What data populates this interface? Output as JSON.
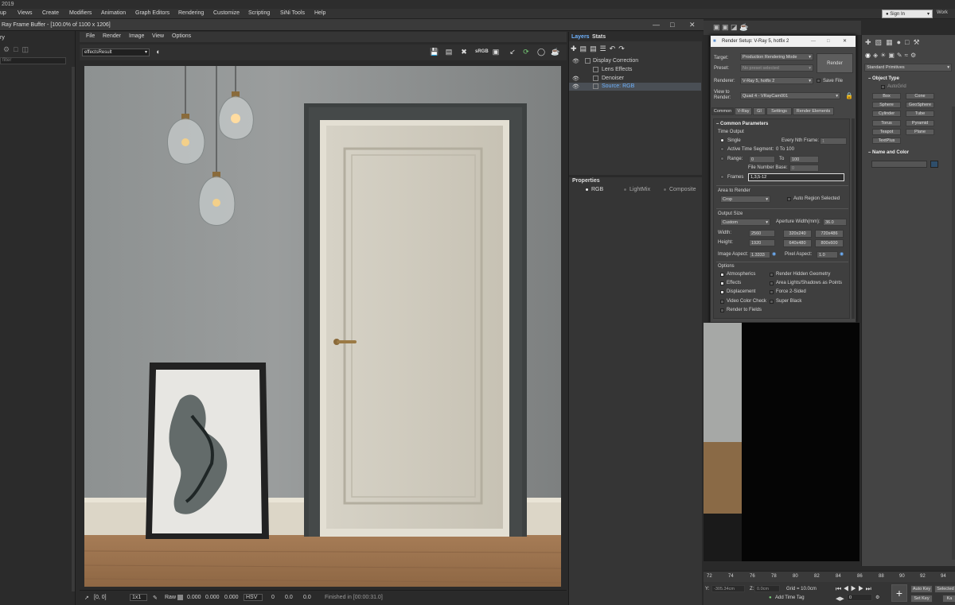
{
  "app": {
    "title": "2019",
    "signin": "Sign In",
    "workspace": "Work"
  },
  "menu": [
    "up",
    "Views",
    "Create",
    "Modifiers",
    "Animation",
    "Graph Editors",
    "Rendering",
    "Customize",
    "Scripting",
    "SiNi Tools",
    "Help"
  ],
  "left": {
    "label": "ry",
    "search": "filter"
  },
  "vfb": {
    "title": "Ray Frame Buffer - [100.0% of 1100 x 1206]",
    "menu": [
      "File",
      "Render",
      "Image",
      "View",
      "Options"
    ],
    "channel": "effectsResult",
    "status": {
      "coords": "[0, 0]",
      "zoom": "1x1",
      "raw": "Raw",
      "r": "0.000",
      "g": "0.000",
      "b": "0.000",
      "mode": "HSV",
      "h": "0",
      "s": "0.0",
      "v": "0.0",
      "finished": "Finished in [00:00:31.0]"
    }
  },
  "layers": {
    "tabs": [
      "Layers",
      "Stats"
    ],
    "items": [
      "Display Correction",
      "Lens Effects",
      "Denoiser",
      "Source: RGB"
    ],
    "properties_title": "Properties",
    "properties_options": [
      "RGB",
      "LightMix",
      "Composite"
    ]
  },
  "render_setup": {
    "title": "Render Setup: V-Ray 5, hotfix 2",
    "target_label": "Target:",
    "target": "Production Rendering Mode",
    "preset_label": "Preset:",
    "preset": "No preset selected",
    "renderer_label": "Renderer:",
    "renderer": "V-Ray 5, hotfix 2",
    "save_file": "Save File",
    "view_label": "View to Render:",
    "view": "Quad 4 - VRayCam001",
    "render_btn": "Render",
    "tabs": [
      "Common",
      "V-Ray",
      "GI",
      "Settings",
      "Render Elements"
    ],
    "section": "Common Parameters",
    "time_output": "Time Output",
    "single": "Single",
    "every_nth": "Every Nth Frame:",
    "every_nth_val": "1",
    "active_seg": "Active Time Segment:",
    "active_seg_val": "0 To 100",
    "range": "Range:",
    "range_from": "0",
    "to": "To",
    "range_to": "100",
    "file_base": "File Number Base:",
    "file_base_val": "0",
    "frames": "Frames",
    "frames_val": "1,3,5-12",
    "area_label": "Area to Render",
    "area": "Crop",
    "auto_region": "Auto Region Selected",
    "output_size": "Output Size",
    "size_preset": "Custom",
    "aperture": "Aperture Width(mm):",
    "aperture_val": "36.0",
    "width_label": "Width:",
    "width": "2560",
    "height_label": "Height:",
    "height": "1920",
    "presets": [
      "320x240",
      "720x486",
      "640x480",
      "800x600"
    ],
    "image_aspect": "Image Aspect:",
    "image_aspect_val": "1.3333",
    "pixel_aspect": "Pixel Aspect:",
    "pixel_aspect_val": "1.0",
    "options_label": "Options",
    "options_left": [
      "Atmospherics",
      "Effects",
      "Displacement",
      "Video Color Check",
      "Render to Fields"
    ],
    "options_left_checked": [
      true,
      true,
      true,
      false,
      false
    ],
    "options_right": [
      "Render Hidden Geometry",
      "Area Lights/Shadows as Points",
      "Force 2-Sided",
      "Super Black"
    ]
  },
  "command_panel": {
    "category": "Standard Primitives",
    "object_type": "Object Type",
    "autogrid": "AutoGrid",
    "objects": [
      "Box",
      "Cone",
      "Sphere",
      "GeoSphere",
      "Cylinder",
      "Tube",
      "Torus",
      "Pyramid",
      "Teapot",
      "Plane",
      "TextPlus"
    ],
    "name_color": "Name and Color"
  },
  "timeline": {
    "ticks": [
      "72",
      "74",
      "76",
      "78",
      "80",
      "82",
      "84",
      "86",
      "88",
      "90",
      "92",
      "94"
    ]
  },
  "bottom": {
    "y_label": "Y:",
    "y_val": "-305.34cm",
    "z_label": "Z:",
    "z_val": "0.0cm",
    "grid": "Grid = 10.0cm",
    "add_time_tag": "Add Time Tag",
    "frame": "0",
    "auto_key": "Auto Key",
    "selected": "Selected",
    "set_key": "Set Key",
    "key_filters": "Ka"
  }
}
